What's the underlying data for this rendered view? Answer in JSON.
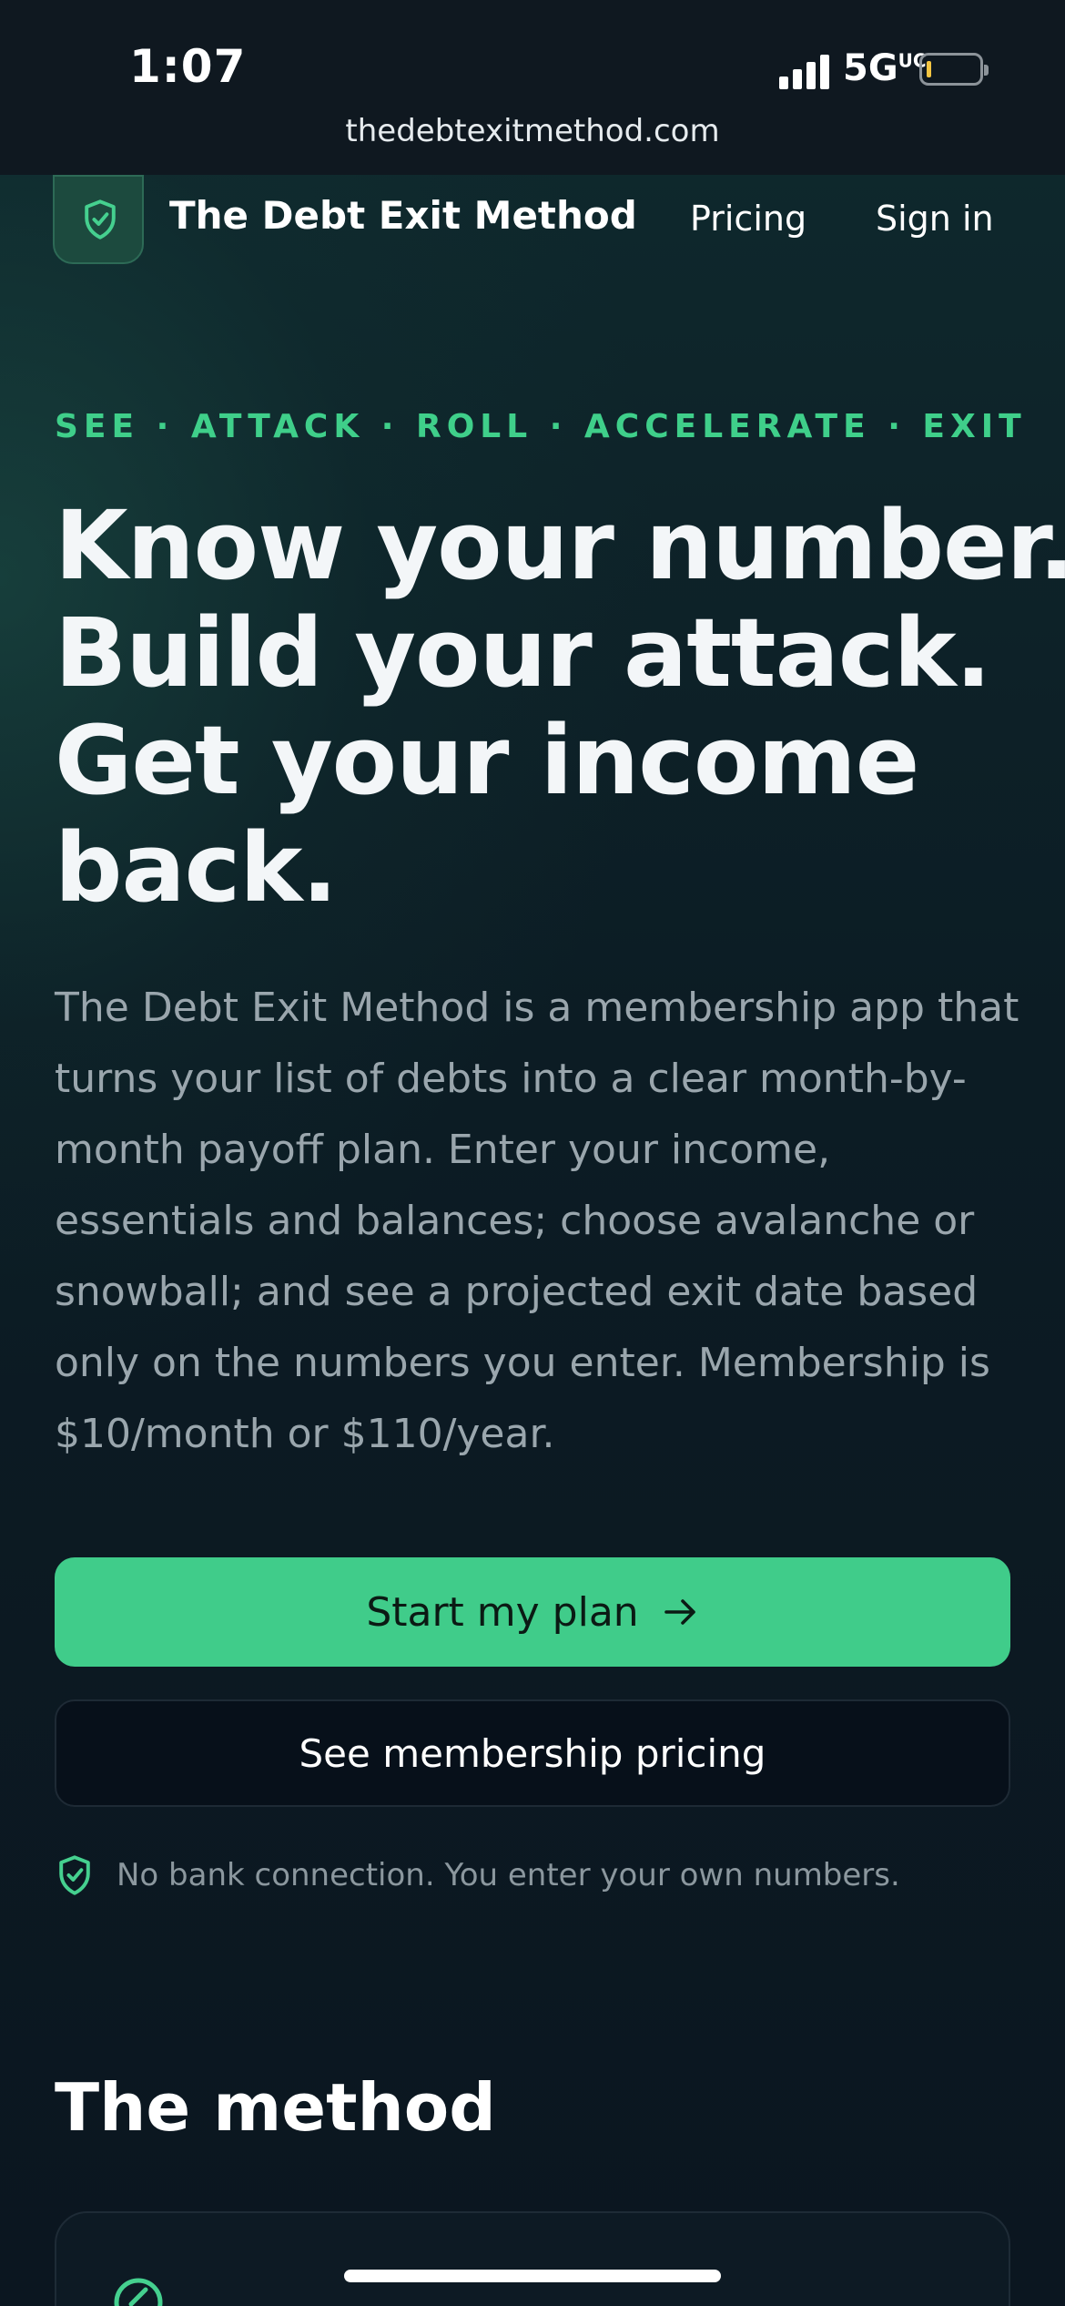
{
  "status_bar": {
    "time": "1:07",
    "network": "5G",
    "network_suffix": "UC",
    "battery_color": "#f4c542"
  },
  "browser": {
    "url": "thedebtexitmethod.com"
  },
  "nav": {
    "logo_icon": "shield-check-icon",
    "brand": "The Debt Exit Method",
    "pricing": "Pricing",
    "sign_in": "Sign in"
  },
  "hero": {
    "eyebrow": "SEE · ATTACK · ROLL · ACCELERATE · EXIT",
    "headline_lines": [
      "Know your number.",
      "Build your attack.",
      "Get your income",
      "back."
    ],
    "description": "The Debt Exit Method is a membership app that turns your list of debts into a clear month-by-month payoff plan. Enter your income, essentials and balances; choose avalanche or snowball; and see a projected exit date based only on the numbers you enter. Membership is $10/month or $110/year.",
    "primary_cta": "Start my plan",
    "primary_cta_icon": "arrow-right-icon",
    "secondary_cta": "See membership pricing",
    "note_icon": "shield-check-icon",
    "note": "No bank connection. You enter your own numbers."
  },
  "method": {
    "title": "The method",
    "card_icon": "gauge-icon"
  },
  "colors": {
    "accent": "#40cc8a",
    "eyebrow": "#3fcf8a",
    "background": "#0b1520"
  }
}
